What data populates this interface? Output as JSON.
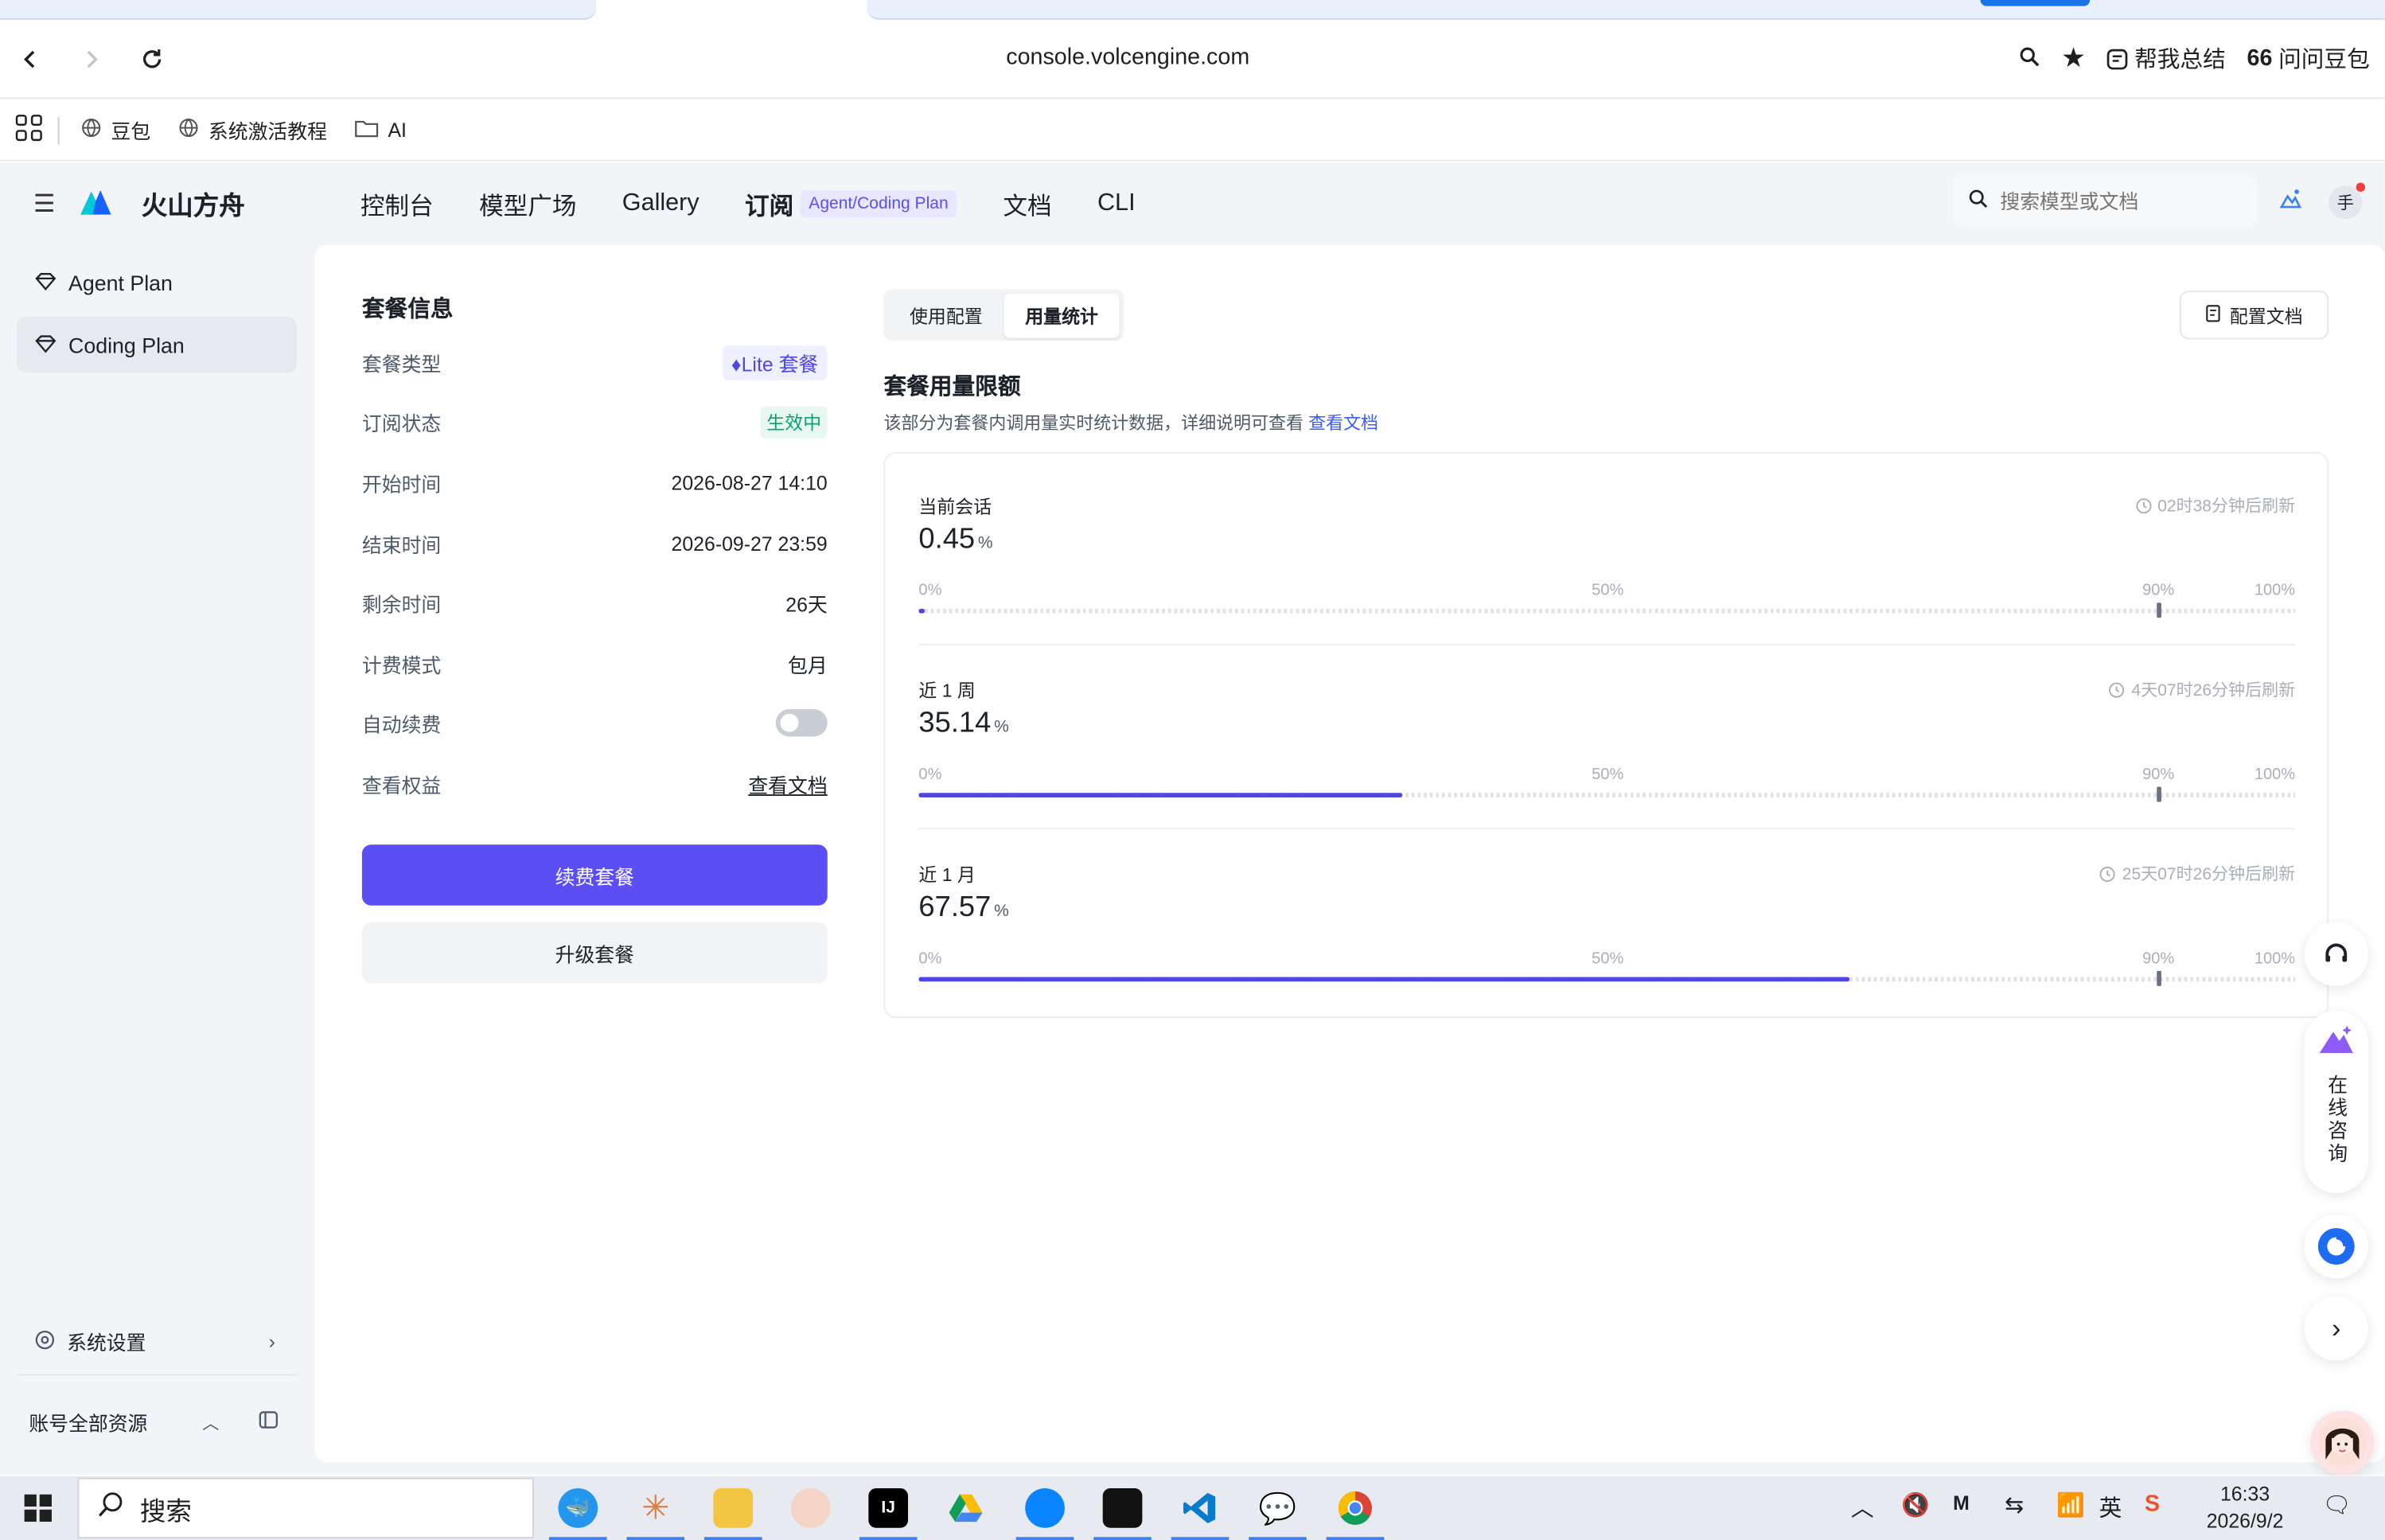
{
  "browser": {
    "url": "console.volcengine.com",
    "summarize_label": "帮我总结",
    "ask_label": "问问豆包",
    "bookmarks": [
      {
        "label": "豆包"
      },
      {
        "label": "系统激活教程"
      },
      {
        "label": "AI"
      }
    ]
  },
  "app": {
    "brand": "火山方舟",
    "nav": {
      "console": "控制台",
      "models": "模型广场",
      "gallery": "Gallery",
      "subscribe": "订阅",
      "subscribe_badge": "Agent/Coding Plan",
      "docs": "文档",
      "cli": "CLI"
    },
    "search_placeholder": "搜索模型或文档",
    "avatar_text": "手",
    "accent_color": "#5b4ef5"
  },
  "sidebar": {
    "items": [
      {
        "label": "Agent Plan"
      },
      {
        "label": "Coding Plan"
      }
    ],
    "settings_label": "系统设置",
    "account_label": "账号全部资源"
  },
  "plan_info": {
    "title": "套餐信息",
    "rows": [
      {
        "label": "套餐类型",
        "value": "Lite 套餐"
      },
      {
        "label": "订阅状态",
        "value": "生效中"
      },
      {
        "label": "开始时间",
        "value": "2026-08-27 14:10"
      },
      {
        "label": "结束时间",
        "value": "2026-09-27 23:59"
      },
      {
        "label": "剩余时间",
        "value": "26天"
      },
      {
        "label": "计费模式",
        "value": "包月"
      },
      {
        "label": "自动续费",
        "value": ""
      },
      {
        "label": "查看权益",
        "value": "查看文档"
      }
    ],
    "auto_renew_on": false,
    "renew_button": "续费套餐",
    "upgrade_button": "升级套餐"
  },
  "usage": {
    "tabs": [
      "使用配置",
      "用量统计"
    ],
    "active_tab": "用量统计",
    "doc_button": "配置文档",
    "title": "套餐用量限额",
    "desc": "该部分为套餐内调用量实时统计数据，详细说明可查看",
    "desc_link": "查看文档",
    "ticks": [
      "0%",
      "50%",
      "90%",
      "100%"
    ],
    "unit": "%",
    "sections": [
      {
        "name": "当前会话",
        "value": "0.45",
        "percent": 0.45,
        "refresh": "02时38分钟后刷新"
      },
      {
        "name": "近 1 周",
        "value": "35.14",
        "percent": 35.14,
        "refresh": "4天07时26分钟后刷新"
      },
      {
        "name": "近 1 月",
        "value": "67.57",
        "percent": 67.57,
        "refresh": "25天07时26分钟后刷新"
      }
    ]
  },
  "floating": {
    "consult_label": "在线咨询"
  },
  "taskbar": {
    "search_label": "搜索",
    "time": "16:33",
    "date": "2026/9/2"
  }
}
